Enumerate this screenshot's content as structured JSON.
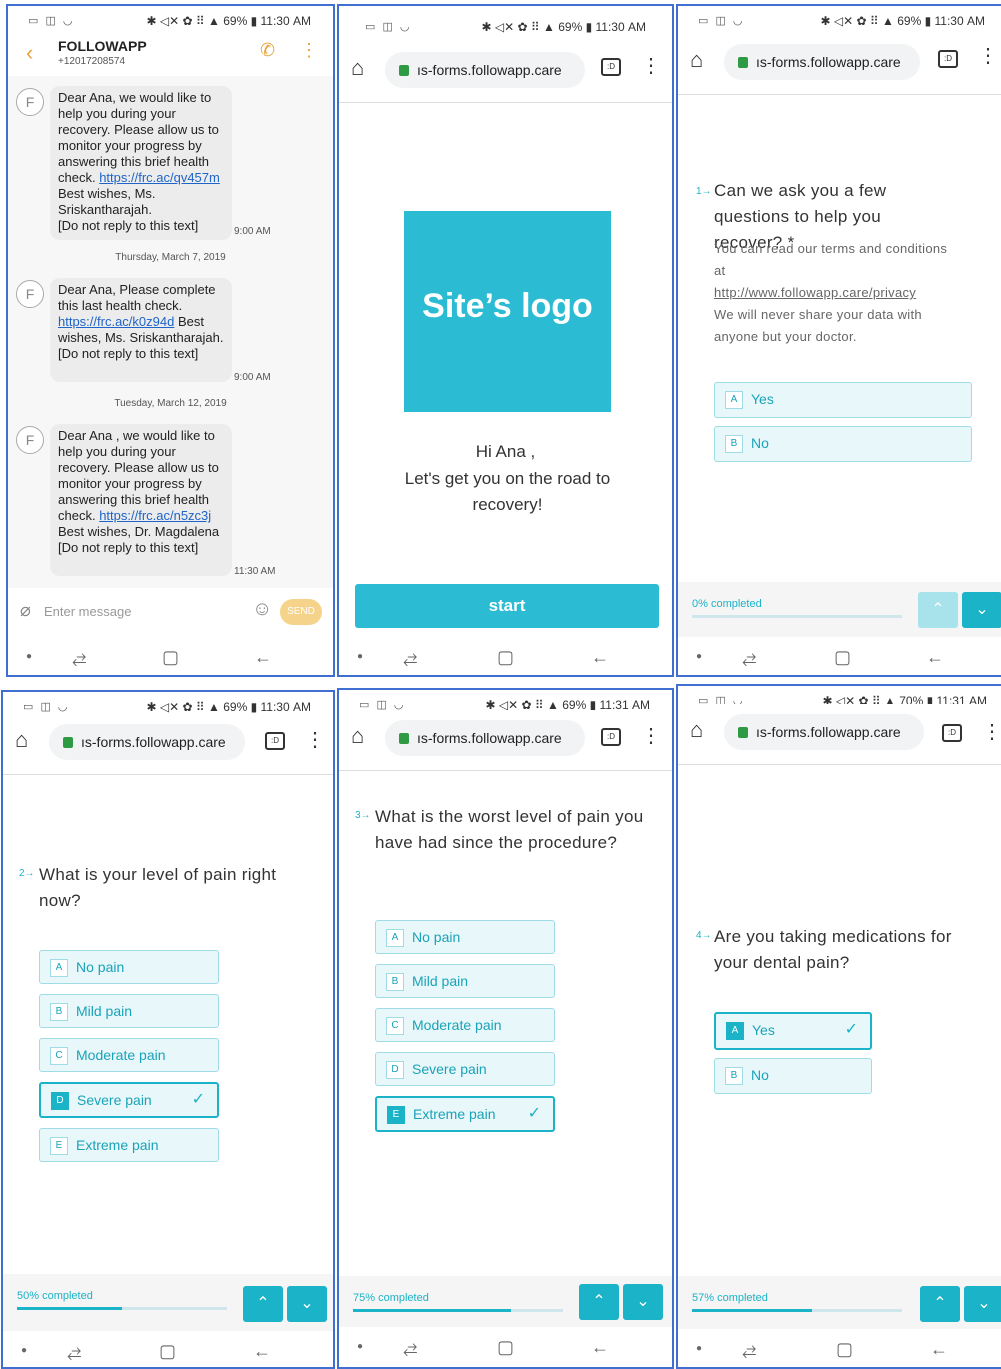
{
  "status": {
    "icons_left": "▭ ◫ ◡",
    "icons_right_1130": "✱ ◁✕ ✿ ⠿ ▲ 69% ▮ 11:30 AM",
    "icons_right_1131_69": "✱ ◁✕ ✿ ⠿ ▲ 69% ▮ 11:31 AM",
    "icons_right_1131_70": "✱ ◁✕ ✿ ⠿ ▲ 70% ▮ 11:31 AM"
  },
  "browser": {
    "url": "ıs-forms.followapp.care",
    "tabs_count": ":D"
  },
  "sms": {
    "contact_name": "FOLLOWAPP",
    "contact_number": "+12017208574",
    "avatar_letter": "F",
    "messages": [
      {
        "text_before": "Dear Ana, we would like to help you during your recovery. Please allow us to monitor your progress by answering this brief health check. ",
        "link": "https://frc.ac/qv457m",
        "text_after": " Best wishes, Ms. Sriskantharajah.",
        "footer": "[Do not reply to this text]",
        "time": "9:00 AM"
      },
      {
        "date": "Thursday, March 7, 2019",
        "text_before": "Dear Ana, Please complete this last health check. ",
        "link": "https://frc.ac/k0z94d",
        "text_after": " Best wishes, Ms. Sriskantharajah.",
        "footer": "[Do not reply to this text]",
        "time": "9:00 AM"
      },
      {
        "date": "Tuesday, March 12, 2019",
        "text_before": "Dear Ana , we would like to help you during your recovery. Please allow us to monitor your progress by answering this brief health check. ",
        "link": "https://frc.ac/n5zc3j",
        "text_after": " Best wishes, Dr. Magdalena",
        "footer": "[Do not reply to this text]",
        "time": "11:30 AM"
      }
    ],
    "input_placeholder": "Enter message",
    "send_label": "SEND"
  },
  "welcome": {
    "logo_text": "Site’s logo",
    "greeting": "Hi Ana ,",
    "subtitle": "Let's get you on the road to recovery!",
    "start_label": "start",
    "logo_color": "#2bbcd4"
  },
  "q1": {
    "number": "1→",
    "question": "Can we ask you a few questions to help you recover? *",
    "terms_line1": "You can read our terms and conditions at",
    "terms_link": "http://www.followapp.care/privacy",
    "terms_line2": "We will never share your data with anyone but your doctor.",
    "options": [
      {
        "key": "A",
        "label": "Yes"
      },
      {
        "key": "B",
        "label": "No"
      }
    ],
    "progress_label": "0% completed",
    "progress_fraction": 0.0
  },
  "q2": {
    "number": "2→",
    "question": "What is your level of pain right now?",
    "options": [
      {
        "key": "A",
        "label": "No pain"
      },
      {
        "key": "B",
        "label": "Mild pain"
      },
      {
        "key": "C",
        "label": "Moderate pain"
      },
      {
        "key": "D",
        "label": "Severe pain"
      },
      {
        "key": "E",
        "label": "Extreme pain"
      }
    ],
    "selected": "D",
    "progress_label": "50% completed",
    "progress_fraction": 0.5
  },
  "q3": {
    "number": "3→",
    "question": "What is the worst level of pain you have had since the procedure?",
    "options": [
      {
        "key": "A",
        "label": "No pain"
      },
      {
        "key": "B",
        "label": "Mild pain"
      },
      {
        "key": "C",
        "label": "Moderate pain"
      },
      {
        "key": "D",
        "label": "Severe pain"
      },
      {
        "key": "E",
        "label": "Extreme pain"
      }
    ],
    "selected": "E",
    "progress_label": "75% completed",
    "progress_fraction": 0.75
  },
  "q4": {
    "number": "4→",
    "question": "Are you taking medications for your dental pain?",
    "options": [
      {
        "key": "A",
        "label": "Yes"
      },
      {
        "key": "B",
        "label": "No"
      }
    ],
    "selected": "A",
    "progress_label": "57% completed",
    "progress_fraction": 0.57
  },
  "colors": {
    "accent": "#1bb3c7",
    "panel_border": "#3f6fd1"
  }
}
